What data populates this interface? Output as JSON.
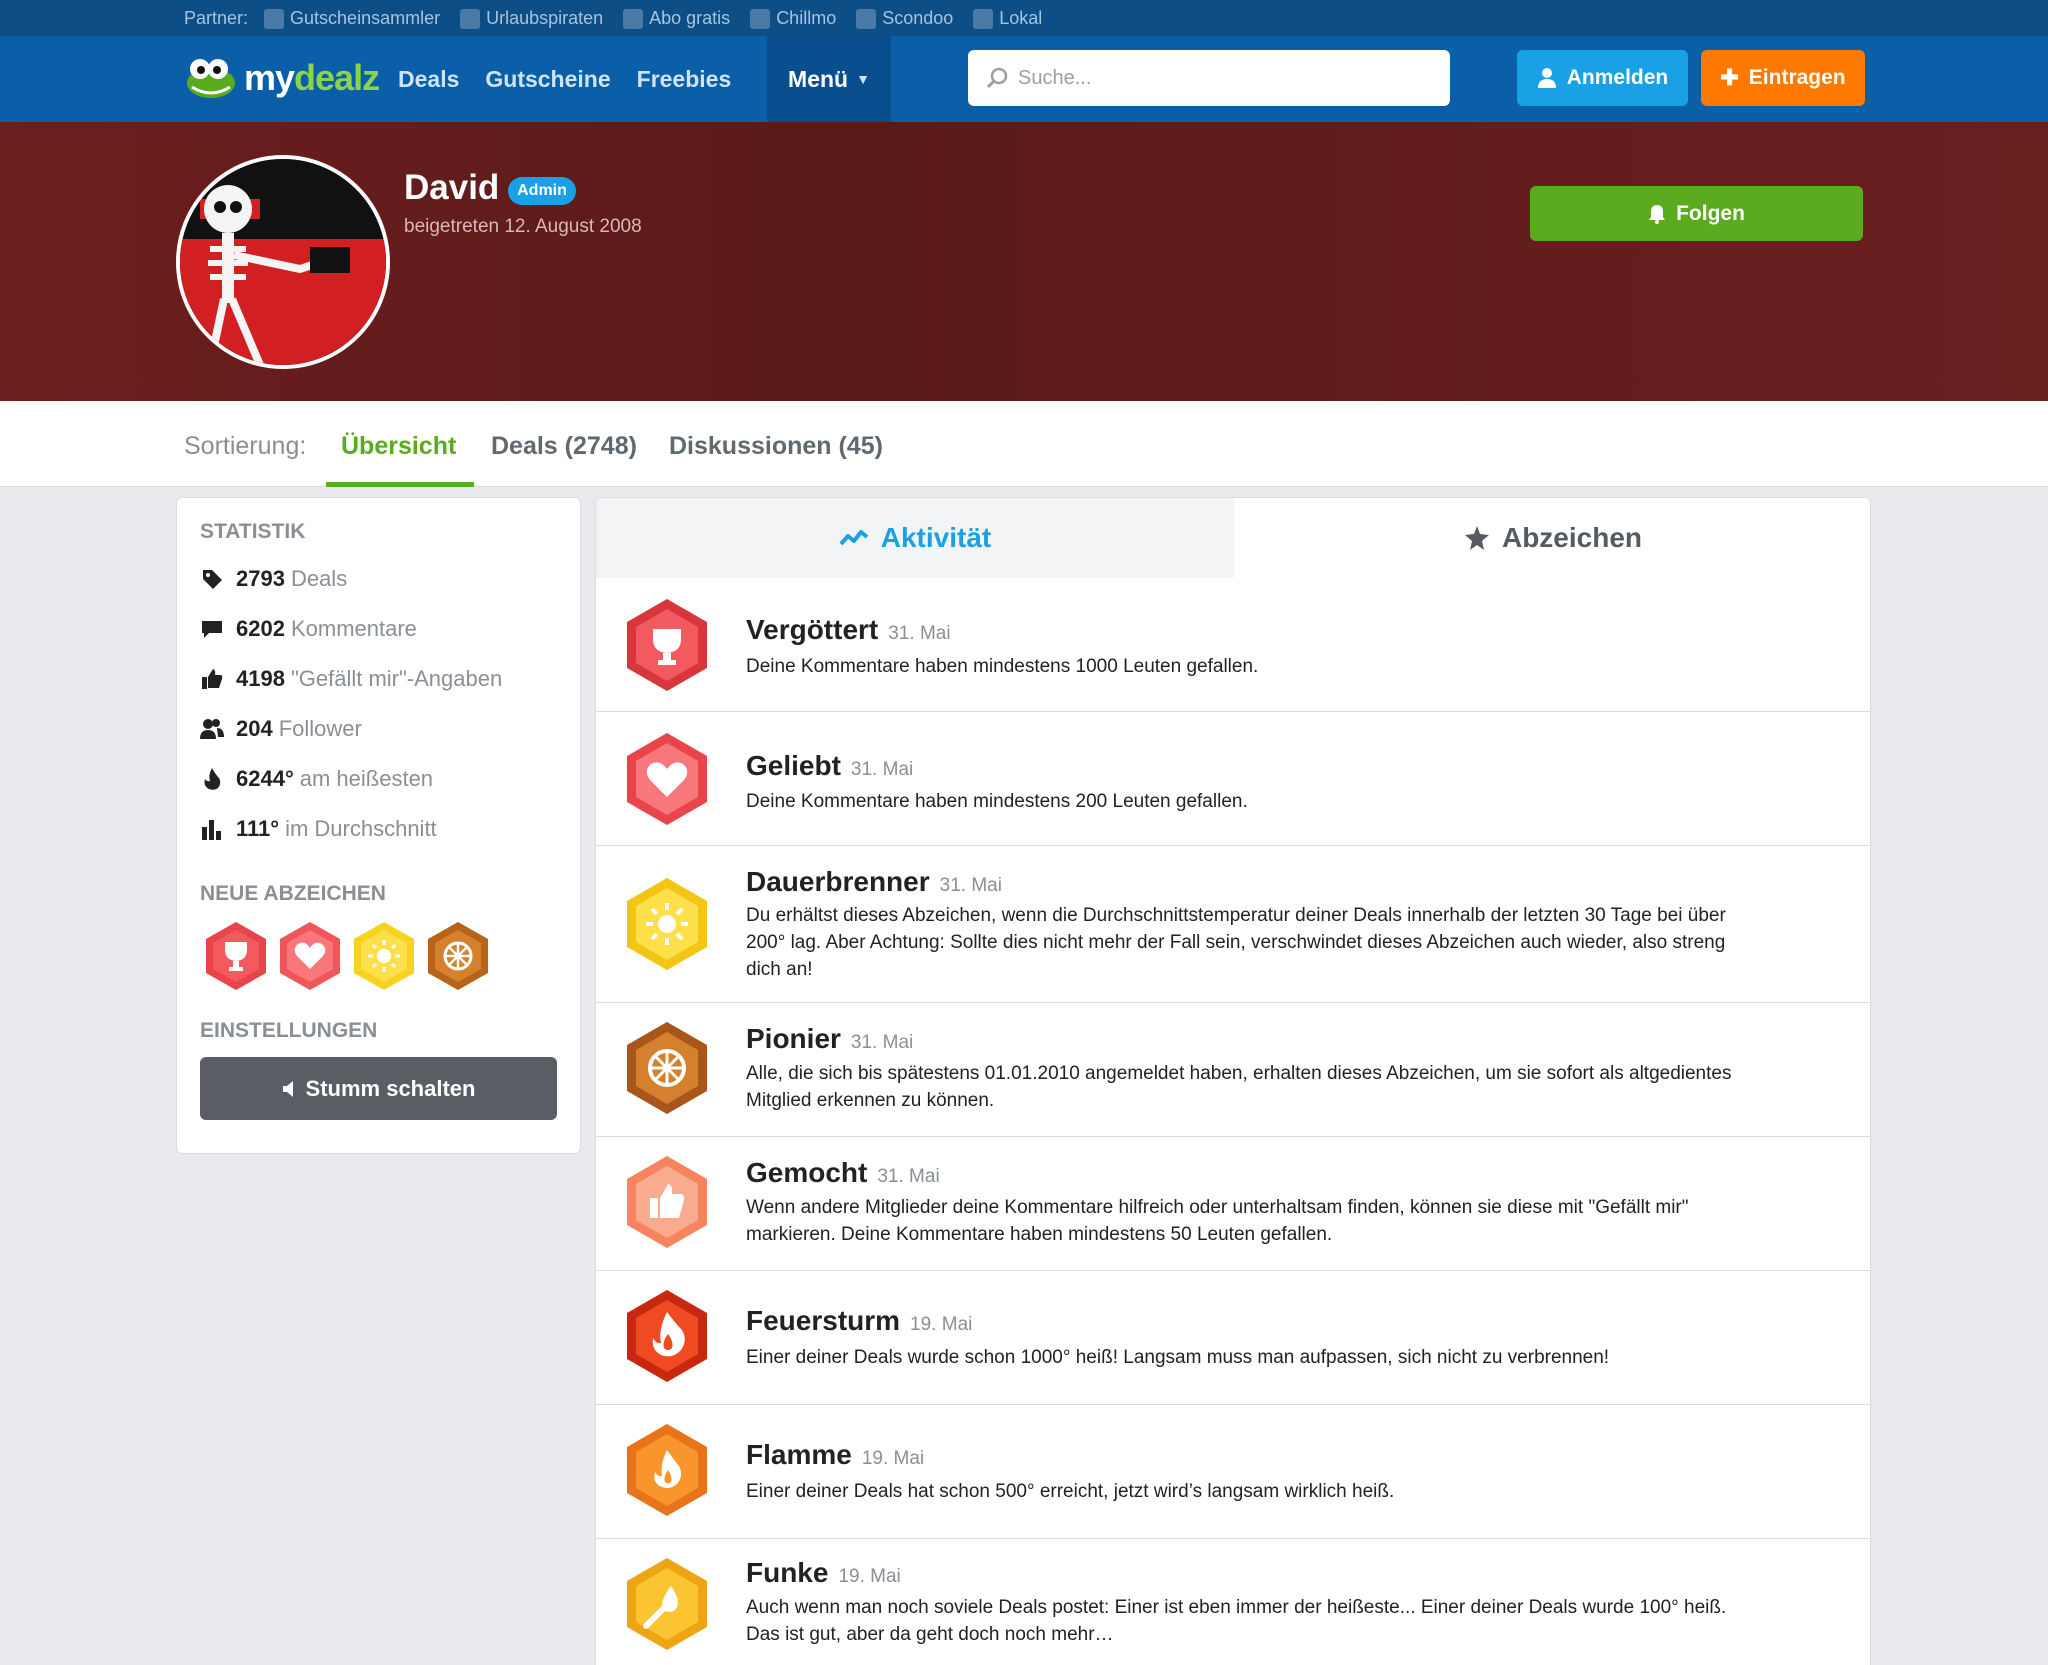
{
  "partner_bar": {
    "label": "Partner:",
    "links": [
      "Gutscheinsammler",
      "Urlaubspiraten",
      "Abo gratis",
      "Chillmo",
      "Scondoo",
      "Lokal"
    ]
  },
  "header": {
    "logo_my": "my",
    "logo_dealz": "dealz",
    "nav": [
      "Deals",
      "Gutscheine",
      "Freebies"
    ],
    "menu_label": "Menü",
    "search_placeholder": "Suche...",
    "login_label": "Anmelden",
    "post_label": "Eintragen"
  },
  "profile": {
    "name": "David",
    "badge": "Admin",
    "joined": "beigetreten 12. August 2008",
    "follow_label": "Folgen"
  },
  "sortbar": {
    "label": "Sortierung:",
    "tabs": [
      "Übersicht",
      "Deals (2748)",
      "Diskussionen (45)"
    ]
  },
  "sidebar": {
    "stats_heading": "STATISTIK",
    "stats": [
      {
        "value": "2793",
        "label": "Deals",
        "icon": "tag-icon"
      },
      {
        "value": "6202",
        "label": "Kommentare",
        "icon": "comment-icon"
      },
      {
        "value": "4198",
        "label": "\"Gefällt mir\"-Angaben",
        "icon": "thumbs-up-icon"
      },
      {
        "value": "204",
        "label": "Follower",
        "icon": "users-icon"
      },
      {
        "value": "6244°",
        "label": "am heißesten",
        "icon": "flame-icon"
      },
      {
        "value": "111°",
        "label": "im Durchschnitt",
        "icon": "bar-chart-icon"
      }
    ],
    "badges_heading": "NEUE ABZEICHEN",
    "settings_heading": "EINSTELLUNGEN",
    "mute_label": "Stumm schalten"
  },
  "tabs": {
    "activity": "Aktivität",
    "badges": "Abzeichen"
  },
  "activity": [
    {
      "title": "Vergöttert",
      "date": "31. Mai",
      "desc": "Deine Kommentare haben mindestens 1000 Leuten gefallen.",
      "icon": "trophy-icon",
      "color": "#e8444a"
    },
    {
      "title": "Geliebt",
      "date": "31. Mai",
      "desc": "Deine Kommentare haben mindestens 200 Leuten gefallen.",
      "icon": "heart-icon",
      "color": "#f0555a"
    },
    {
      "title": "Dauerbrenner",
      "date": "31. Mai",
      "desc": "Du erhältst dieses Abzeichen, wenn die Durchschnittstemperatur deiner Deals innerhalb der letzten 30 Tage bei über 200° lag. Aber Achtung: Sollte dies nicht mehr der Fall sein, verschwindet dieses Abzeichen auch wieder, also streng dich an!",
      "icon": "sun-icon",
      "color": "#f7d21e"
    },
    {
      "title": "Pionier",
      "date": "31. Mai",
      "desc": "Alle, die sich bis spätestens 01.01.2010 angemeldet haben, erhalten dieses Abzeichen, um sie sofort als altgedientes Mitglied erkennen zu können.",
      "icon": "wheel-icon",
      "color": "#c9701c"
    },
    {
      "title": "Gemocht",
      "date": "31. Mai",
      "desc": "Wenn andere Mitglieder deine Kommentare hilfreich oder unterhaltsam finden, können sie diese mit \"Gefällt mir\" markieren. Deine Kommentare haben mindestens 50 Leuten gefallen.",
      "icon": "thumbs-up-icon",
      "color": "#f79070"
    },
    {
      "title": "Feuersturm",
      "date": "19. Mai",
      "desc": "Einer deiner Deals wurde schon 1000° heiß! Langsam muss man aufpassen, sich nicht zu verbrennen!",
      "icon": "firestorm-icon",
      "color": "#e53c1c"
    },
    {
      "title": "Flamme",
      "date": "19. Mai",
      "desc": "Einer deiner Deals hat schon 500° erreicht, jetzt wird’s langsam wirklich heiß.",
      "icon": "flame-icon",
      "color": "#f5831c"
    },
    {
      "title": "Funke",
      "date": "19. Mai",
      "desc": "Auch wenn man noch soviele Deals postet: Einer ist eben immer der heißeste... Einer deiner Deals wurde 100° heiß. Das ist gut, aber da geht doch noch mehr…",
      "icon": "match-icon",
      "color": "#f7b51c"
    }
  ]
}
